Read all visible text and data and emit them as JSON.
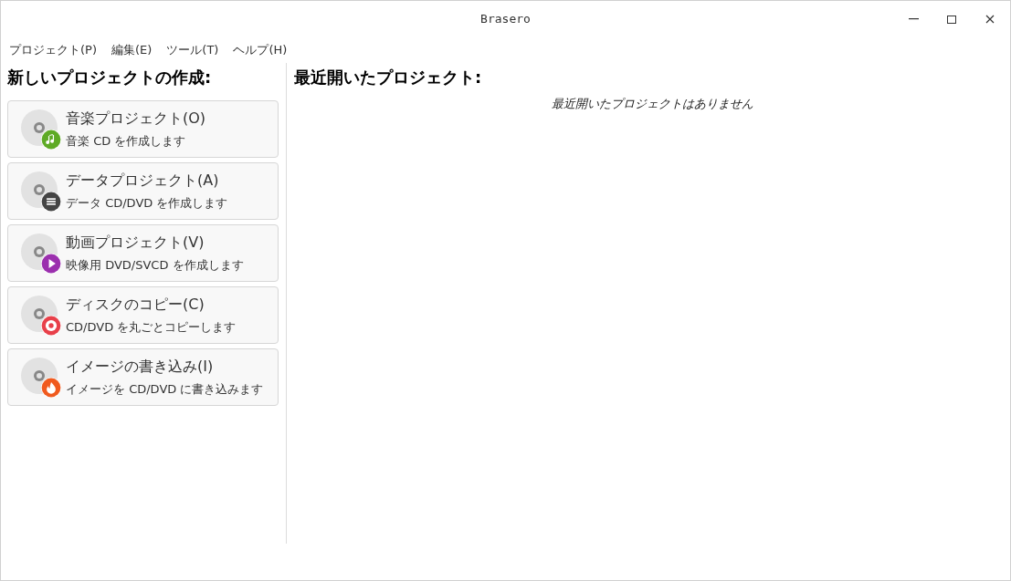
{
  "window": {
    "title": "Brasero"
  },
  "menu": [
    "プロジェクト(P)",
    "編集(E)",
    "ツール(T)",
    "ヘルプ(H)"
  ],
  "new_project": {
    "heading": "新しいプロジェクトの作成:",
    "items": [
      {
        "kind": "music",
        "title": "音楽プロジェクト(O)",
        "subtitle": "音楽 CD を作成します"
      },
      {
        "kind": "data",
        "title": "データプロジェクト(A)",
        "subtitle": "データ CD/DVD を作成します"
      },
      {
        "kind": "video",
        "title": "動画プロジェクト(V)",
        "subtitle": "映像用 DVD/SVCD を作成します"
      },
      {
        "kind": "copy",
        "title": "ディスクのコピー(C)",
        "subtitle": "CD/DVD を丸ごとコピーします"
      },
      {
        "kind": "burn",
        "title": "イメージの書き込み(I)",
        "subtitle": "イメージを CD/DVD に書き込みます"
      }
    ]
  },
  "recent": {
    "heading": "最近開いたプロジェクト:",
    "empty_message": "最近開いたプロジェクトはありません"
  }
}
